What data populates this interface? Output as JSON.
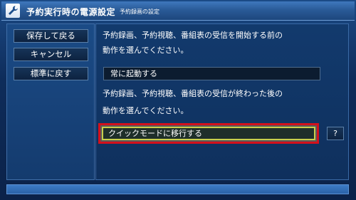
{
  "header": {
    "title": "予約実行時の電源設定",
    "subtitle": "予約録画の設定",
    "icon": "wrench-icon"
  },
  "sidebar": {
    "buttons": [
      {
        "label": "保存して戻る"
      },
      {
        "label": "キャンセル"
      },
      {
        "label": "標準に戻す"
      }
    ]
  },
  "main": {
    "before_prompt_line1": "予約録画、予約視聴、番組表の受信を開始する前の",
    "before_prompt_line2": "動作を選んでください。",
    "before_value": "常に起動する",
    "after_prompt_line1": "予約録画、予約視聴、番組表の受信が終わった後の",
    "after_prompt_line2": "動作を選んでください。",
    "after_value": "クイックモードに移行する",
    "help_label": "?"
  },
  "colors": {
    "highlight_border": "#d3111c",
    "focus_border": "#c8cf4c",
    "background": "#0e2c5a"
  }
}
